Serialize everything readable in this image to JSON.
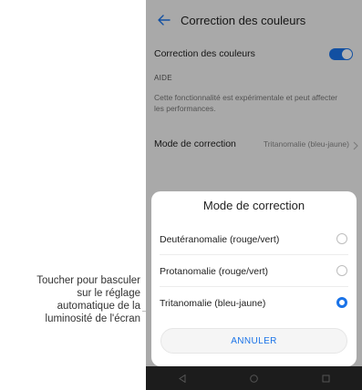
{
  "callout": {
    "lines": [
      "Toucher pour basculer",
      "sur le réglage",
      "automatique de la",
      "luminosité de l'écran"
    ]
  },
  "screen": {
    "title": "Correction des couleurs",
    "toggle_label": "Correction des couleurs",
    "toggle_on": true,
    "section": "AIDE",
    "description": "Cette fonctionnalité est expérimentale et peut affecter les performances.",
    "mode_label": "Mode de correction",
    "mode_value": "Tritanomalie (bleu-jaune)"
  },
  "dialog": {
    "title": "Mode de correction",
    "options": [
      {
        "label": "Deutéranomalie (rouge/vert)",
        "selected": false
      },
      {
        "label": "Protanomalie (rouge/vert)",
        "selected": false
      },
      {
        "label": "Tritanomalie (bleu-jaune)",
        "selected": true
      }
    ],
    "cancel": "ANNULER"
  },
  "icons": {
    "back": "back-arrow-icon",
    "chevron": "chevron-right-icon",
    "nav": [
      "nav-back-icon",
      "nav-home-icon",
      "nav-recents-icon"
    ]
  },
  "colors": {
    "accent": "#1a73e8",
    "screen_bg": "#f2f2f2",
    "sheet_bg": "#ffffff"
  }
}
